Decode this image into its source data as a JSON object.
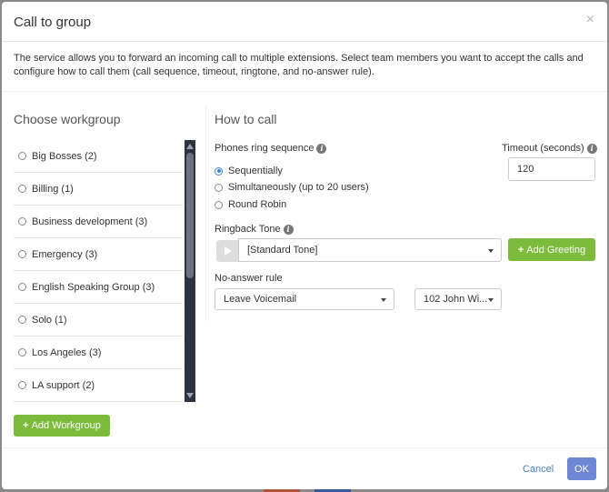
{
  "dialog": {
    "title": "Call to group",
    "close_glyph": "×",
    "description": "The service allows you to forward an incoming call to multiple extensions. Select team members you want to accept the calls and configure how to call them (call sequence, timeout, ringtone, and no-answer rule)."
  },
  "workgroup": {
    "heading": "Choose workgroup",
    "items": [
      {
        "label": "Big Bosses (2)"
      },
      {
        "label": "Billing (1)"
      },
      {
        "label": "Business development (3)"
      },
      {
        "label": "Emergency (3)"
      },
      {
        "label": "English Speaking Group (3)"
      },
      {
        "label": "Solo (1)"
      },
      {
        "label": "Los Angeles (3)"
      },
      {
        "label": "LA support (2)"
      }
    ],
    "add_button": "Add Workgroup"
  },
  "how_to_call": {
    "heading": "How to call",
    "sequence_label": "Phones ring sequence",
    "options": [
      {
        "label": "Sequentially",
        "checked": true
      },
      {
        "label": "Simultaneously (up to 20 users)",
        "checked": false
      },
      {
        "label": "Round Robin",
        "checked": false
      }
    ],
    "timeout_label": "Timeout (seconds)",
    "timeout_value": "120",
    "ringback_label": "Ringback Tone",
    "ringback_value": "[Standard Tone]",
    "add_greeting_button": "Add Greeting",
    "no_answer_label": "No-answer rule",
    "no_answer_value": "Leave Voicemail",
    "voicemail_target": "102 John Wi..."
  },
  "footer": {
    "cancel": "Cancel",
    "ok": "OK"
  },
  "colors": {
    "accent_green": "#7dbb3d",
    "ok_blue": "#6f86d6",
    "scrollbar": "#2a3340"
  }
}
